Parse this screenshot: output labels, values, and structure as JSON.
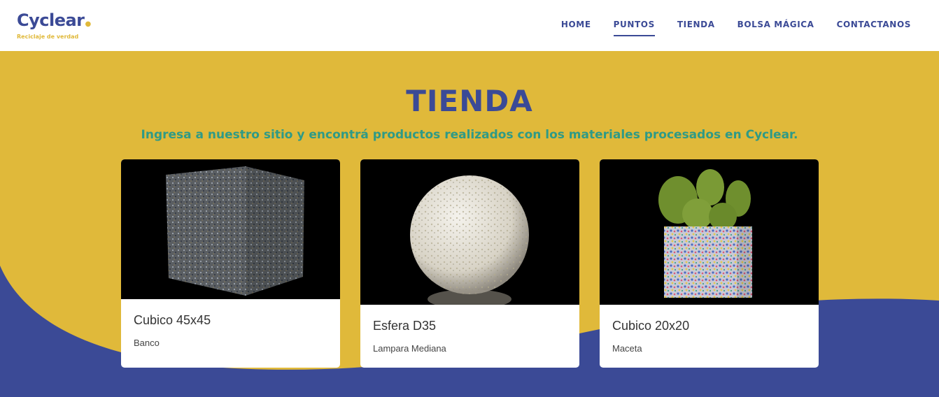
{
  "logo": {
    "name": "Cyclear",
    "tagline": "Reciclaje de verdad"
  },
  "nav": [
    {
      "label": "HOME",
      "active": false
    },
    {
      "label": "PUNTOS",
      "active": true
    },
    {
      "label": "TIENDA",
      "active": false
    },
    {
      "label": "BOLSA MÁGICA",
      "active": false
    },
    {
      "label": "CONTACTANOS",
      "active": false
    }
  ],
  "section": {
    "title": "TIENDA",
    "subtitle": "Ingresa a nuestro sitio y encontrá productos realizados con los materiales procesados en Cyclear."
  },
  "products": [
    {
      "title": "Cubico 45x45",
      "subtitle": "Banco",
      "image_icon": "speckled-cube-image"
    },
    {
      "title": "Esfera D35",
      "subtitle": "Lampara Mediana",
      "image_icon": "speckled-sphere-image"
    },
    {
      "title": "Cubico 20x20",
      "subtitle": "Maceta",
      "image_icon": "cactus-planter-image"
    }
  ],
  "colors": {
    "primary": "#3b4a96",
    "accent": "#e0b93a",
    "teal": "#2f9a86",
    "white": "#ffffff"
  }
}
